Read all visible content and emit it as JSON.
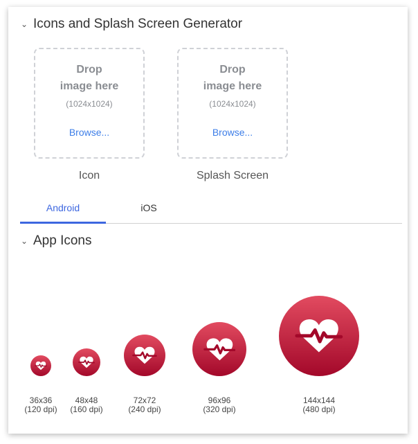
{
  "generator": {
    "title": "Icons and Splash Screen Generator",
    "drop_zones": [
      {
        "line1": "Drop",
        "line2": "image here",
        "size": "(1024x1024)",
        "browse": "Browse...",
        "label": "Icon"
      },
      {
        "line1": "Drop",
        "line2": "image here",
        "size": "(1024x1024)",
        "browse": "Browse...",
        "label": "Splash Screen"
      }
    ]
  },
  "tabs": [
    {
      "label": "Android",
      "active": true
    },
    {
      "label": "iOS",
      "active": false
    }
  ],
  "app_icons": {
    "title": "App Icons",
    "accent_gradient": [
      "#e24b60",
      "#a3082a"
    ],
    "items": [
      {
        "size": "36x36",
        "dpi": "(120 dpi)"
      },
      {
        "size": "48x48",
        "dpi": "(160 dpi)"
      },
      {
        "size": "72x72",
        "dpi": "(240 dpi)"
      },
      {
        "size": "96x96",
        "dpi": "(320 dpi)"
      },
      {
        "size": "144x144",
        "dpi": "(480 dpi)"
      }
    ]
  }
}
